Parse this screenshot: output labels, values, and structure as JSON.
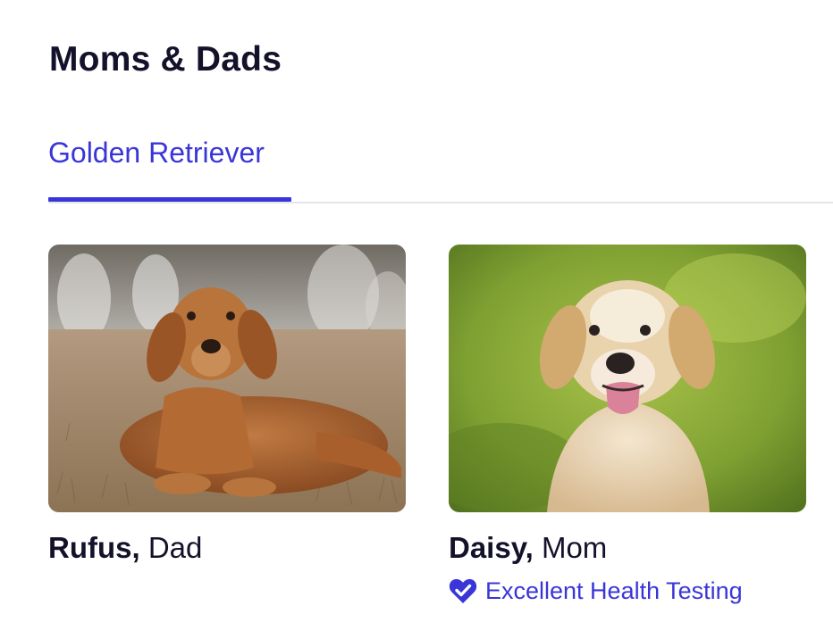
{
  "section": {
    "title": "Moms & Dads"
  },
  "tabs": [
    {
      "label": "Golden Retriever",
      "active": true
    }
  ],
  "parents": [
    {
      "name": "Rufus,",
      "role": "Dad",
      "photo_alt": "Rufus",
      "health_badge": null
    },
    {
      "name": "Daisy,",
      "role": "Mom",
      "photo_alt": "Daisy",
      "health_badge": {
        "label": "Excellent Health Testing",
        "icon": "heart-check-icon"
      }
    }
  ],
  "colors": {
    "accent": "#3a35d9",
    "text": "#14122b",
    "divider": "#e5e5ea"
  }
}
